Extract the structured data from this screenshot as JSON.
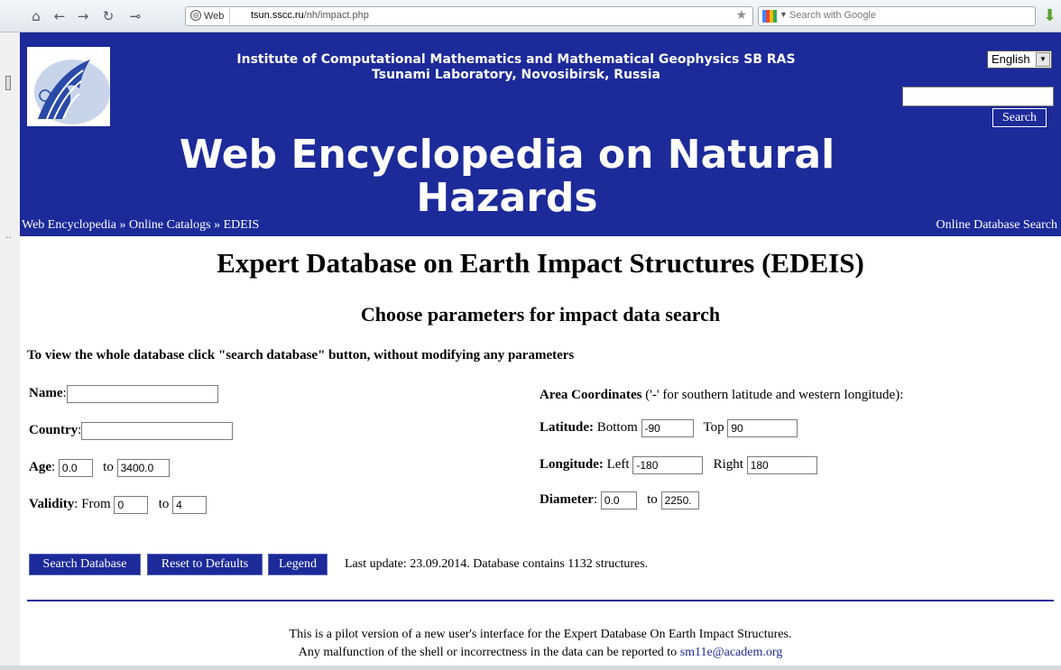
{
  "browser": {
    "identity_label": "Web",
    "url_host": "tsun.sscc.ru",
    "url_path": "/nh/impact.php",
    "search_placeholder": "Search with Google"
  },
  "header": {
    "institute_line1": "Institute of Computational Mathematics and Mathematical Geophysics SB RAS",
    "institute_line2": "Tsunami Laboratory, Novosibirsk, Russia",
    "site_title_line1": "Web Encyclopedia on Natural",
    "site_title_line2": "Hazards",
    "language": "English",
    "search_button": "Search",
    "breadcrumb": [
      "Web Encyclopedia",
      "Online Catalogs",
      "EDEIS"
    ],
    "breadcrumb_sep": " » ",
    "online_search_link": "Online Database Search"
  },
  "main": {
    "title": "Expert Database on Earth Impact Structures (EDEIS)",
    "subtitle": "Choose parameters for impact data search",
    "note": "To view the whole database click \"search database\" button, without modifying any parameters"
  },
  "form": {
    "name_label": "Name",
    "name_value": "",
    "country_label": "Country",
    "country_value": "",
    "age_label": "Age",
    "age_from": "0.0",
    "age_to_label": "to",
    "age_to": "3400.0",
    "validity_label": "Validity",
    "validity_from_label": "From",
    "validity_from": "0",
    "validity_to_label": "to",
    "validity_to": "4",
    "area_label": "Area Coordinates",
    "area_hint": " ('-' for southern latitude and western longitude):",
    "latitude_label": "Latitude:",
    "lat_bottom_label": "Bottom",
    "lat_bottom": "-90",
    "lat_top_label": "Top",
    "lat_top": "90",
    "longitude_label": "Longitude:",
    "lon_left_label": "Left",
    "lon_left": "-180",
    "lon_right_label": "Right",
    "lon_right": "180",
    "diameter_label": "Diameter",
    "diam_from": "0.0",
    "diam_to_label": "to",
    "diam_to": "2250."
  },
  "buttons": {
    "search": "Search Database",
    "reset": "Reset to Defaults",
    "legend": "Legend"
  },
  "status": {
    "last_update": "Last update: 23.09.2014. Database contains 1132 structures."
  },
  "footer": {
    "line1": "This is a pilot version of a new user's interface for the Expert Database On Earth Impact Structures.",
    "line2_prefix": "Any malfunction of the shell or incorrectness in the data can be reported to ",
    "email": "sm11e@academ.org"
  },
  "colors": {
    "header_bg": "#1c2a9a",
    "link": "#1c2a9a"
  }
}
